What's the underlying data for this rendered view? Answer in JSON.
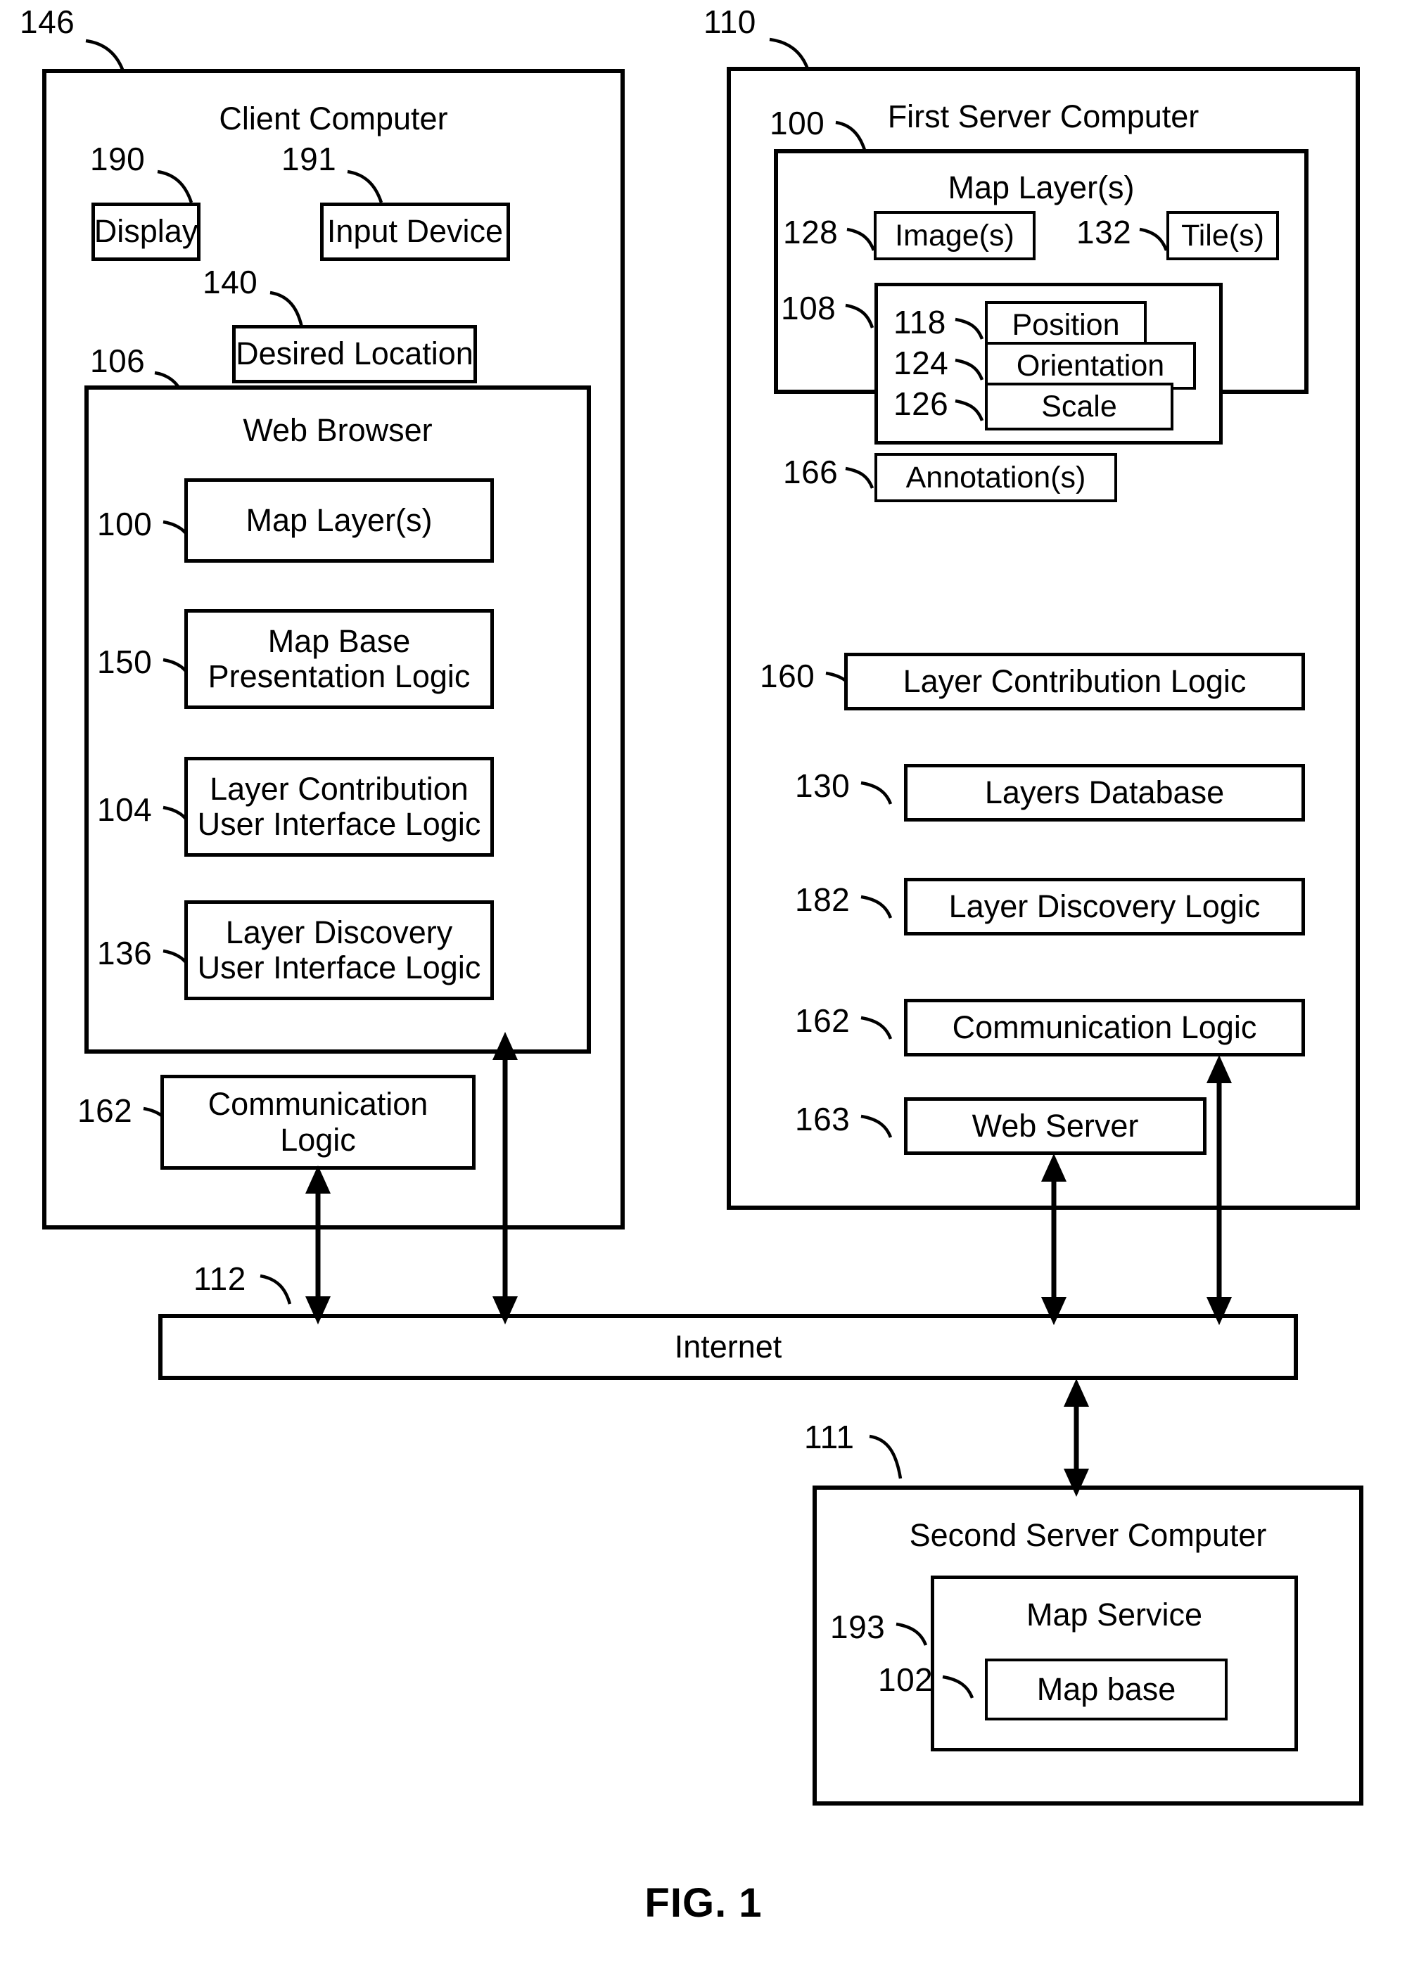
{
  "figure": {
    "caption": "FIG. 1"
  },
  "client_computer": {
    "ref": "146",
    "title": "Client Computer",
    "display": {
      "ref": "190",
      "label": "Display"
    },
    "input_device": {
      "ref": "191",
      "label": "Input Device"
    },
    "desired_location": {
      "ref": "140",
      "label": "Desired Location"
    },
    "web_browser": {
      "ref": "106",
      "title": "Web Browser",
      "items": [
        {
          "ref": "100",
          "label": "Map Layer(s)"
        },
        {
          "ref": "150",
          "label": "Map Base\nPresentation Logic"
        },
        {
          "ref": "104",
          "label": "Layer Contribution\nUser Interface Logic"
        },
        {
          "ref": "136",
          "label": "Layer Discovery\nUser Interface Logic"
        }
      ]
    },
    "communication_logic": {
      "ref": "162",
      "label": "Communication\nLogic"
    }
  },
  "first_server_computer": {
    "ref": "110",
    "title": "First Server Computer",
    "map_layers": {
      "ref": "100",
      "title": "Map Layer(s)",
      "images": {
        "ref": "128",
        "label": "Image(s)"
      },
      "tiles": {
        "ref": "132",
        "label": "Tile(s)"
      },
      "geo_group": {
        "ref": "108",
        "items": [
          {
            "ref": "118",
            "label": "Position"
          },
          {
            "ref": "124",
            "label": "Orientation"
          },
          {
            "ref": "126",
            "label": "Scale"
          }
        ]
      },
      "annotations": {
        "ref": "166",
        "label": "Annotation(s)"
      }
    },
    "items": [
      {
        "ref": "160",
        "label": "Layer Contribution Logic"
      },
      {
        "ref": "130",
        "label": "Layers Database"
      },
      {
        "ref": "182",
        "label": "Layer Discovery Logic"
      },
      {
        "ref": "162",
        "label": "Communication Logic"
      },
      {
        "ref": "163",
        "label": "Web Server"
      }
    ]
  },
  "network": {
    "ref": "112",
    "label": "Internet"
  },
  "second_server_computer": {
    "ref": "111",
    "title": "Second Server Computer",
    "map_service": {
      "ref": "193",
      "title": "Map Service",
      "map_base": {
        "ref": "102",
        "label": "Map base"
      }
    }
  },
  "colors": {
    "stroke": "#000000",
    "background": "#ffffff"
  }
}
